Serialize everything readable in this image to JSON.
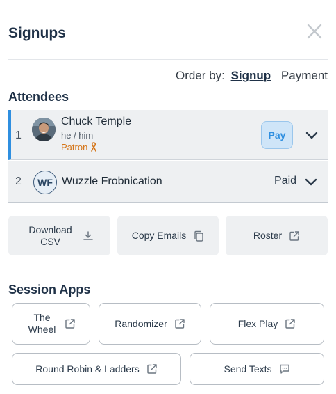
{
  "header": {
    "title": "Signups"
  },
  "order_by": {
    "label": "Order by:",
    "options": [
      "Signup",
      "Payment"
    ],
    "selected": "Signup"
  },
  "attendees": {
    "title": "Attendees",
    "items": [
      {
        "number": "1",
        "name": "Chuck Temple",
        "pronouns": "he / him",
        "badge": "Patron",
        "action": "Pay"
      },
      {
        "number": "2",
        "initials": "WF",
        "name": "Wuzzle Frobnication",
        "status": "Paid"
      }
    ]
  },
  "actions": [
    {
      "label": "Download CSV",
      "icon": "download-icon"
    },
    {
      "label": "Copy Emails",
      "icon": "copy-icon"
    },
    {
      "label": "Roster",
      "icon": "external-link-icon"
    }
  ],
  "session_apps": {
    "title": "Session Apps",
    "items": [
      {
        "label": "The Wheel",
        "icon": "external-link-icon"
      },
      {
        "label": "Randomizer",
        "icon": "external-link-icon"
      },
      {
        "label": "Flex Play",
        "icon": "external-link-icon"
      },
      {
        "label": "Round Robin & Ladders",
        "icon": "external-link-icon"
      },
      {
        "label": "Send Texts",
        "icon": "message-icon"
      }
    ]
  },
  "colors": {
    "accent": "#2f8fe0",
    "patron": "#d5761a",
    "title": "#1f3147"
  }
}
